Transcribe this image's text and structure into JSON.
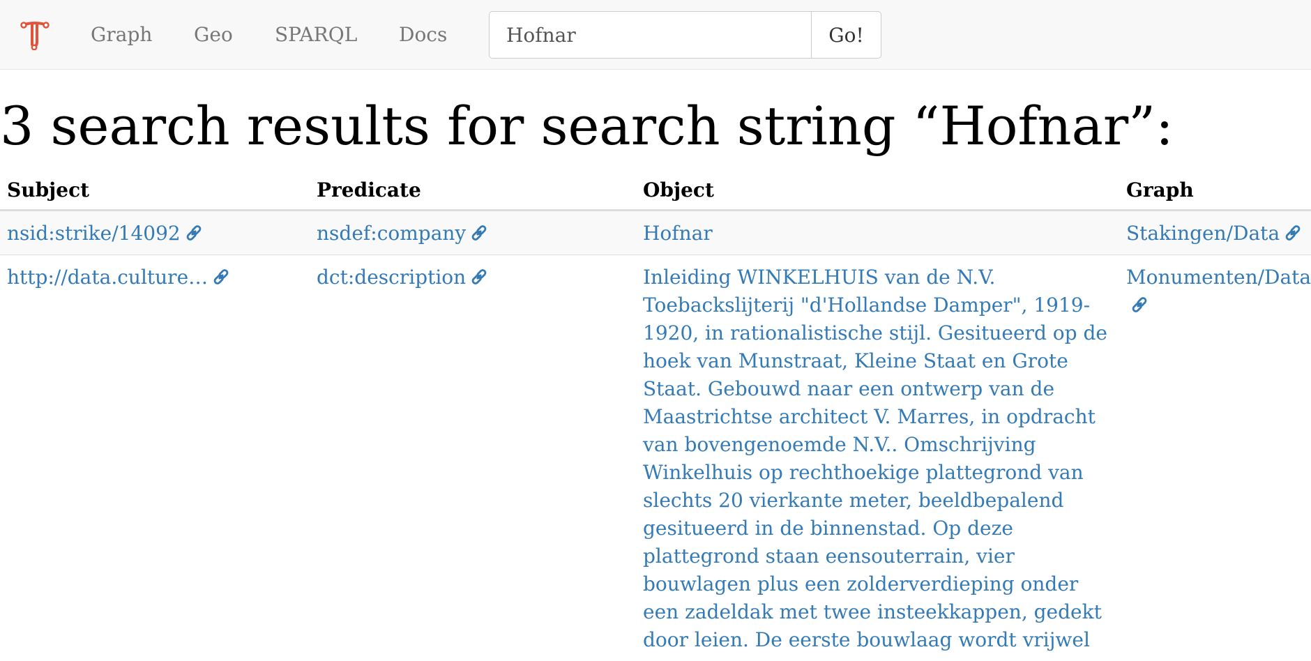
{
  "nav": {
    "logo_icon": "triply-logo-icon",
    "items": [
      "Graph",
      "Geo",
      "SPARQL",
      "Docs"
    ]
  },
  "search": {
    "value": "Hofnar",
    "button_label": "Go!"
  },
  "page_title": "3 search results for search string “Hofnar”:",
  "table": {
    "headers": [
      "Subject",
      "Predicate",
      "Object",
      "Graph"
    ],
    "rows": [
      {
        "subject": "nsid:strike/14092",
        "predicate": "nsdef:company",
        "object": "Hofnar",
        "graph": "Stakingen/Data"
      },
      {
        "subject": "http://data.culture…",
        "predicate": "dct:description",
        "object": "Inleiding WINKELHUIS van de N.V. Toebackslijterij \"d'Hollandse Damper\", 1919-1920, in rationalistische stijl. Gesitueerd op de hoek van Munstraat, Kleine Staat en Grote Staat. Gebouwd naar een ontwerp van de Maastrichtse architect V. Marres, in opdracht van bovengenoemde N.V.. Omschrijving Winkelhuis op rechthoekige plattegrond van slechts 20 vierkante meter, beeldbepalend gesitueerd in de binnenstad. Op deze plattegrond staan eensouterrain, vier bouwlagen plus een zolderverdieping onder een zadeldak met twee insteekkappen, gedekt door leien. De eerste bouwlaag wordt vrijwel",
        "graph": "Monumenten/Data"
      }
    ]
  },
  "colors": {
    "link": "#337ab7",
    "logo": "#e2543a",
    "nav_text": "#777777"
  }
}
